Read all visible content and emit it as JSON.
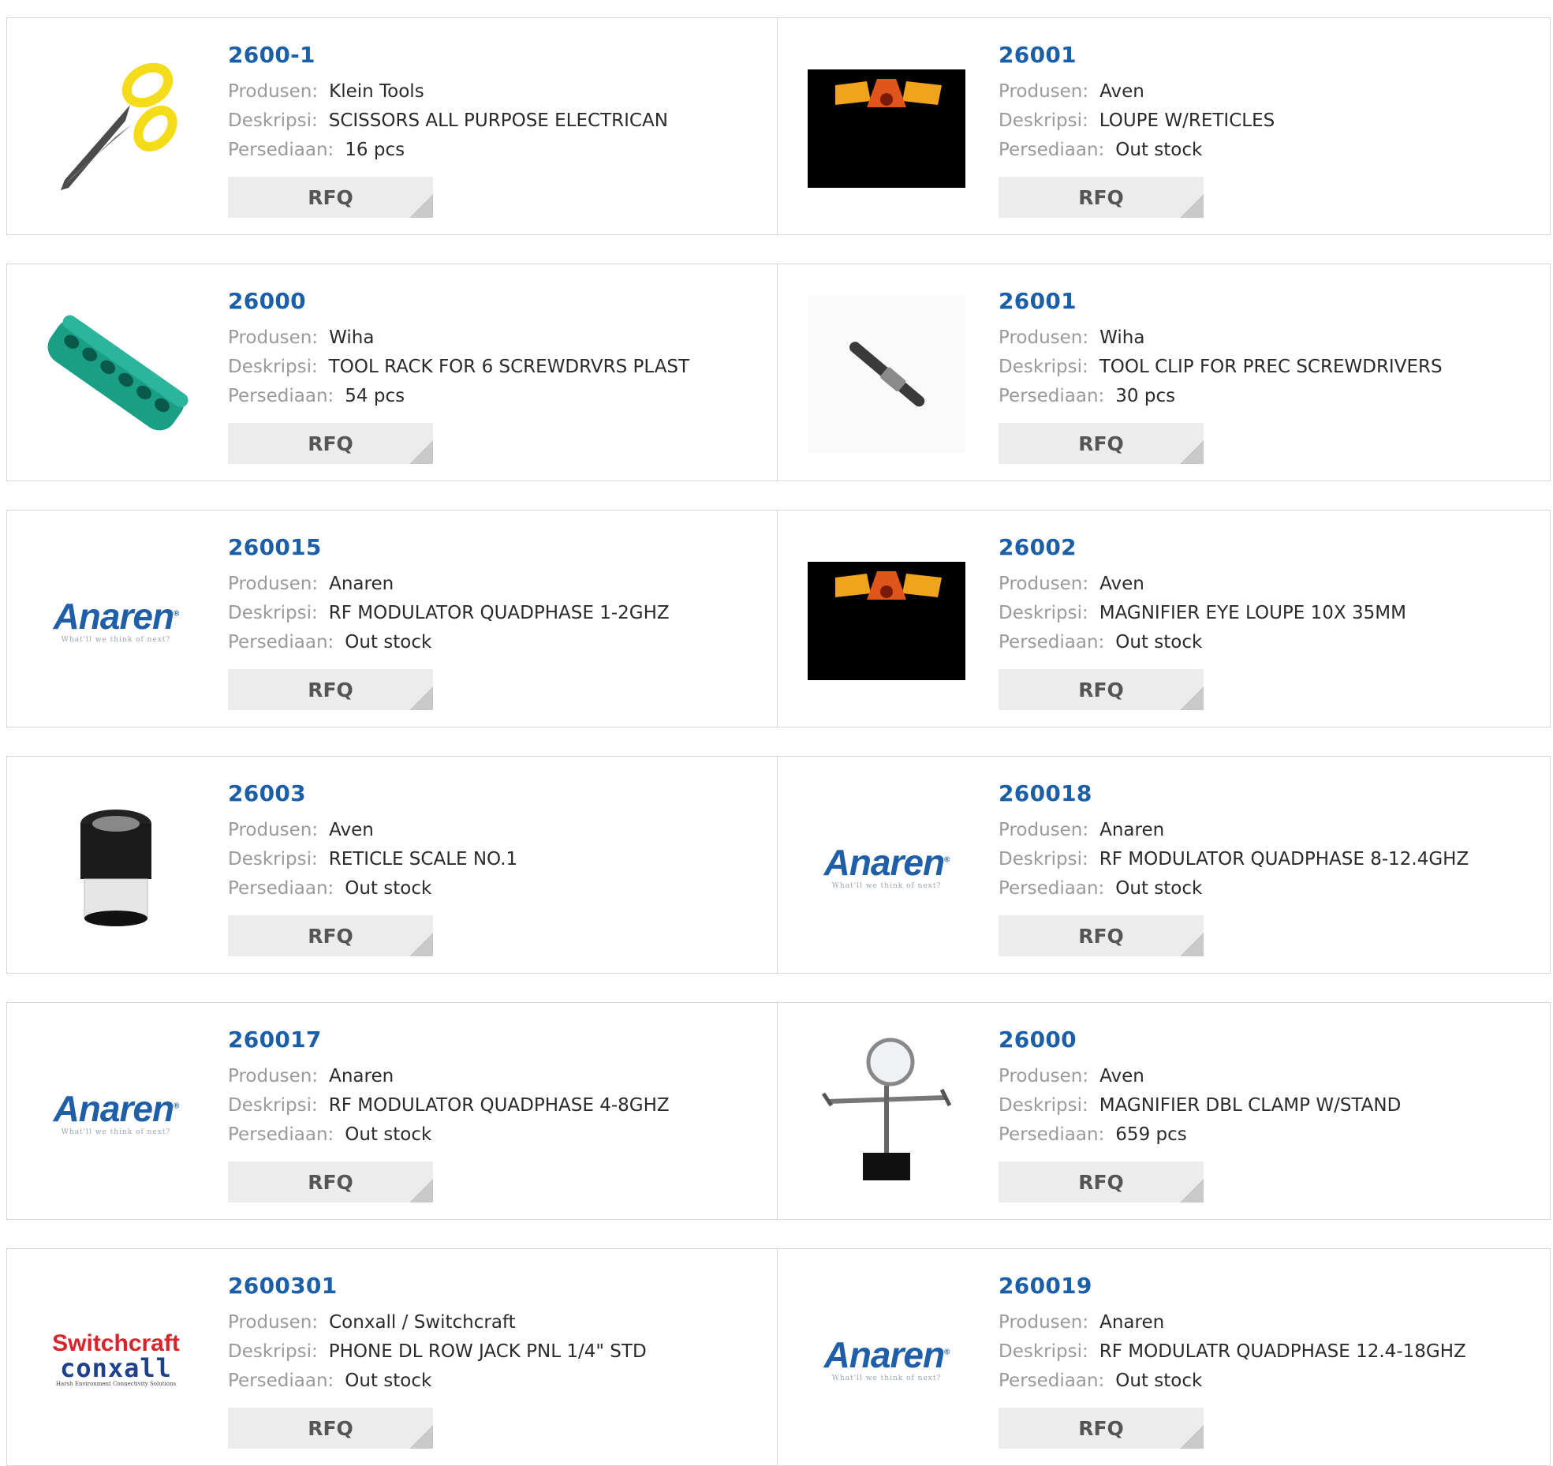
{
  "labels": {
    "produsen": "Produsen:",
    "deskripsi": "Deskripsi:",
    "persediaan": "Persediaan:",
    "rfq": "RFQ"
  },
  "colors": {
    "link": "#1b5fa8",
    "label": "#9a9a9a",
    "border": "#d6d6d6",
    "button": "#ececec"
  },
  "products": [
    {
      "part": "2600-1",
      "manufacturer": "Klein Tools",
      "description": "SCISSORS ALL PURPOSE ELECTRICAN",
      "stock": "16 pcs",
      "image": "scissors-icon"
    },
    {
      "part": "26001",
      "manufacturer": "Aven",
      "description": "LOUPE W/RETICLES",
      "stock": "Out stock",
      "image": "aven-logo-icon"
    },
    {
      "part": "26000",
      "manufacturer": "Wiha",
      "description": "TOOL RACK FOR 6 SCREWDRVRS PLAST",
      "stock": "54 pcs",
      "image": "tool-rack-icon"
    },
    {
      "part": "26001",
      "manufacturer": "Wiha",
      "description": "TOOL CLIP FOR PREC SCREWDRIVERS",
      "stock": "30 pcs",
      "image": "tool-clip-icon"
    },
    {
      "part": "260015",
      "manufacturer": "Anaren",
      "description": "RF MODULATOR QUADPHASE 1-2GHZ",
      "stock": "Out stock",
      "image": "anaren-logo"
    },
    {
      "part": "26002",
      "manufacturer": "Aven",
      "description": "MAGNIFIER EYE LOUPE 10X 35MM",
      "stock": "Out stock",
      "image": "aven-logo-icon"
    },
    {
      "part": "26003",
      "manufacturer": "Aven",
      "description": "RETICLE SCALE NO.1",
      "stock": "Out stock",
      "image": "loupe-icon"
    },
    {
      "part": "260018",
      "manufacturer": "Anaren",
      "description": "RF MODULATOR QUADPHASE 8-12.4GHZ",
      "stock": "Out stock",
      "image": "anaren-logo"
    },
    {
      "part": "260017",
      "manufacturer": "Anaren",
      "description": "RF MODULATOR QUADPHASE 4-8GHZ",
      "stock": "Out stock",
      "image": "anaren-logo"
    },
    {
      "part": "26000",
      "manufacturer": "Aven",
      "description": "MAGNIFIER DBL CLAMP W/STAND",
      "stock": "659 pcs",
      "image": "magnifier-stand-icon"
    },
    {
      "part": "2600301",
      "manufacturer": "Conxall / Switchcraft",
      "description": "PHONE DL ROW JACK PNL 1/4\" STD",
      "stock": "Out stock",
      "image": "switchcraft-logo"
    },
    {
      "part": "260019",
      "manufacturer": "Anaren",
      "description": "RF MODULATR QUADPHASE 12.4-18GHZ",
      "stock": "Out stock",
      "image": "anaren-logo"
    }
  ],
  "logos": {
    "anaren": {
      "word": "Anaren",
      "tagline": "What'll we think of next?"
    },
    "switchcraft": {
      "line1": "Switchcraft",
      "line2": "conxall",
      "tagline": "Harsh Environment Connectivity Solutions"
    }
  }
}
